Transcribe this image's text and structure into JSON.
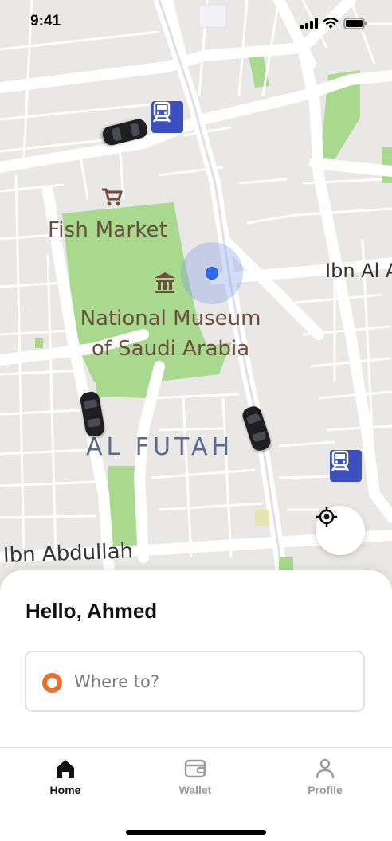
{
  "status_bar": {
    "time": "9:41",
    "icons": [
      "signal-icon",
      "wifi-icon",
      "battery-icon"
    ]
  },
  "map": {
    "places": {
      "fish_market": "Fish Market",
      "museum_line1": "National Museum",
      "museum_line2": "of Saudi Arabia",
      "district": "AL FUTAH",
      "road_right": "Ibn Al A",
      "road_bottom": "Ibn Abdullah"
    },
    "colors": {
      "land": "#e9e8e6",
      "roads": "#ffffff",
      "park": "#a9d98f",
      "transit": "#3b4fc1",
      "user_location": "#2d6bf0"
    },
    "icons": [
      "shopping-cart-icon",
      "museum-icon",
      "train-icon",
      "car-icon",
      "user-location-icon",
      "locate-me-icon"
    ]
  },
  "sheet": {
    "greeting": "Hello, Ahmed",
    "search": {
      "placeholder": "Where to?",
      "value": "",
      "accent": "#e8702a"
    }
  },
  "tabs": [
    {
      "label": "Home",
      "icon": "home-icon",
      "active": true
    },
    {
      "label": "Wallet",
      "icon": "wallet-icon",
      "active": false
    },
    {
      "label": "Profile",
      "icon": "profile-icon",
      "active": false
    }
  ]
}
